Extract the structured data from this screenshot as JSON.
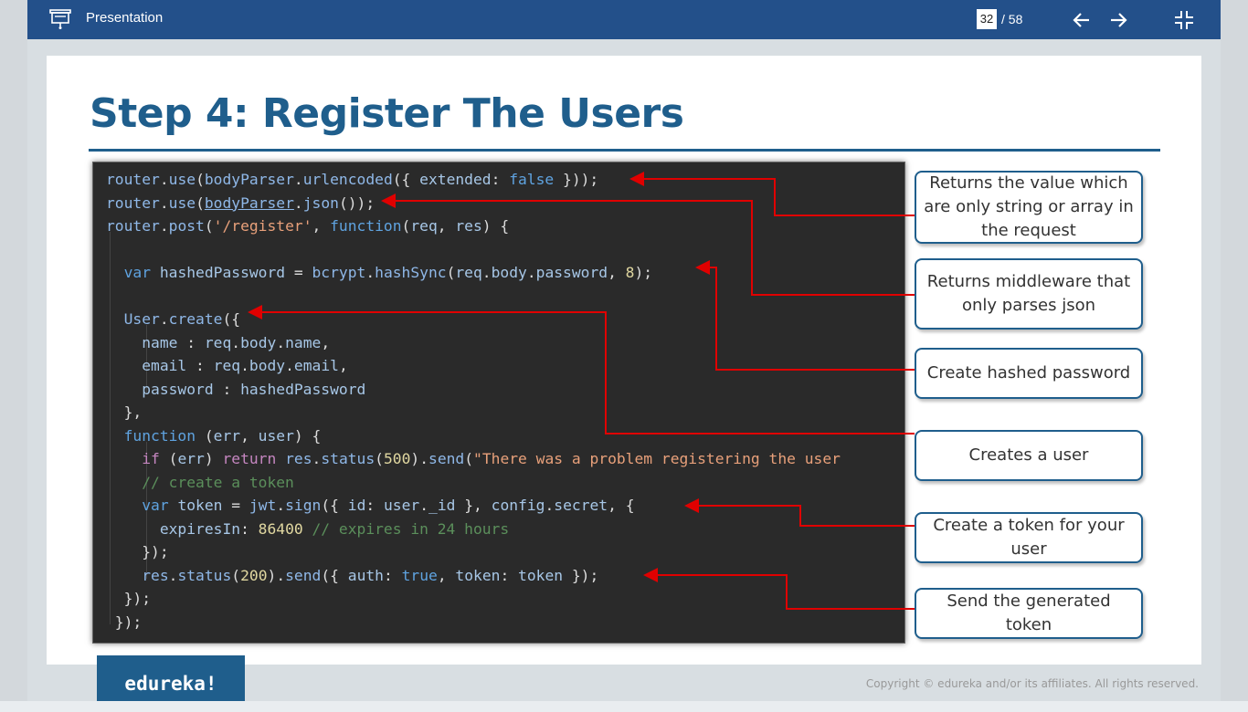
{
  "app": {
    "title": "Presentation",
    "current_page": "32",
    "total_pages": "/ 58"
  },
  "slide": {
    "title": "Step 4: Register The Users",
    "callouts": [
      "Returns the value which are only string or array in the request",
      "Returns middleware that only parses json",
      "Create hashed password",
      "Creates a user",
      "Create a token for your user",
      "Send the generated token"
    ],
    "code_lines": [
      "router.use(bodyParser.urlencoded({ extended: false }));",
      "router.use(bodyParser.json());",
      "router.post('/register', function(req, res) {",
      "",
      "  var hashedPassword = bcrypt.hashSync(req.body.password, 8);",
      "",
      "  User.create({",
      "    name : req.body.name,",
      "    email : req.body.email,",
      "    password : hashedPassword",
      "  },",
      "  function (err, user) {",
      "    if (err) return res.status(500).send(\"There was a problem registering the user",
      "    // create a token",
      "    var token = jwt.sign({ id: user._id }, config.secret, {",
      "      expiresIn: 86400 // expires in 24 hours",
      "    });",
      "    res.status(200).send({ auth: true, token: token });",
      "  });",
      " });"
    ]
  },
  "footer": {
    "logo": "edureka!",
    "copyright": "Copyright © edureka and/or its affiliates. All rights reserved."
  },
  "colors": {
    "topbar": "#23508a",
    "title": "#1f5e8c",
    "arrow": "#e00000",
    "code_bg": "#2a2a2a"
  }
}
